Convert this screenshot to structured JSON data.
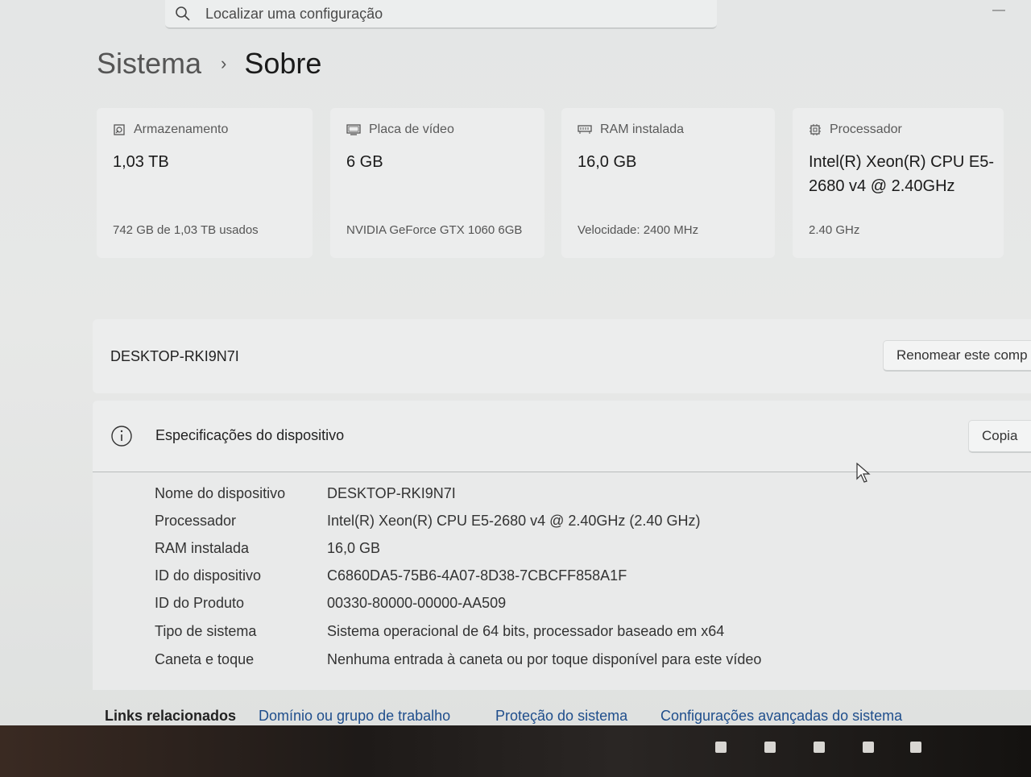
{
  "search": {
    "placeholder": "Localizar uma configuração"
  },
  "breadcrumb": {
    "parent": "Sistema",
    "separator": "›",
    "current": "Sobre"
  },
  "cards": [
    {
      "icon": "storage-icon",
      "label": "Armazenamento",
      "value": "1,03 TB",
      "sub": "742 GB de 1,03 TB usados"
    },
    {
      "icon": "display-icon",
      "label": "Placa de vídeo",
      "value": "6 GB",
      "sub": "NVIDIA GeForce GTX 1060 6GB"
    },
    {
      "icon": "ram-icon",
      "label": "RAM instalada",
      "value": "16,0 GB",
      "sub": "Velocidade: 2400 MHz"
    },
    {
      "icon": "processor-icon",
      "label": "Processador",
      "value": "Intel(R) Xeon(R) CPU E5-2680 v4 @ 2.40GHz",
      "sub": "2.40 GHz"
    }
  ],
  "device_name_row": {
    "name": "DESKTOP-RKI9N7I",
    "rename_button": "Renomear este comp"
  },
  "specs": {
    "title": "Especificações do dispositivo",
    "copy_button": "Copia",
    "rows": [
      {
        "key": "Nome do dispositivo",
        "value": "DESKTOP-RKI9N7I"
      },
      {
        "key": "Processador",
        "value": "Intel(R) Xeon(R) CPU E5-2680 v4 @ 2.40GHz (2.40 GHz)"
      },
      {
        "key": "RAM instalada",
        "value": "16,0 GB"
      },
      {
        "key": "ID do dispositivo",
        "value": "C6860DA5-75B6-4A07-8D38-7CBCFF858A1F"
      },
      {
        "key": "ID do Produto",
        "value": "00330-80000-00000-AA509"
      },
      {
        "key": "Tipo de sistema",
        "value": "Sistema operacional de 64 bits, processador baseado em x64"
      },
      {
        "key": "Caneta e toque",
        "value": "Nenhuma entrada à caneta ou por toque disponível para este vídeo"
      }
    ]
  },
  "related_links": {
    "label": "Links relacionados",
    "links": [
      "Domínio ou grupo de trabalho",
      "Proteção do sistema",
      "Configurações avançadas do sistema"
    ]
  }
}
